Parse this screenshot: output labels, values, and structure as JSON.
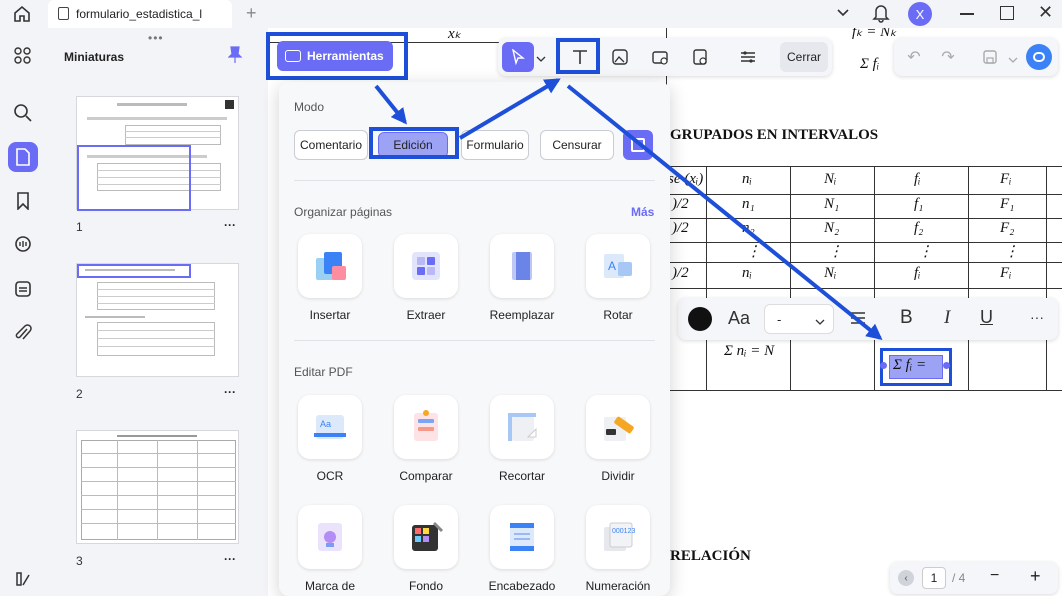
{
  "titlebar": {
    "tab_title": "formulario_estadistica_l",
    "avatar_letter": "X"
  },
  "thumbnails": {
    "title": "Miniaturas",
    "pages": [
      "1",
      "2",
      "3"
    ],
    "more": "···"
  },
  "tools_button": {
    "label": "Herramientas"
  },
  "top_toolbar": {
    "close_label": "Cerrar"
  },
  "panel": {
    "mode_title": "Modo",
    "modes": [
      "Comentario",
      "Edición",
      "Formulario",
      "Censurar"
    ],
    "organize_title": "Organizar páginas",
    "more_label": "Más",
    "organize_tools": [
      "Insertar",
      "Extraer",
      "Reemplazar",
      "Rotar"
    ],
    "edit_title": "Editar PDF",
    "edit_tools": [
      "OCR",
      "Comparar",
      "Recortar",
      "Dividir"
    ],
    "edit_tools_row2": [
      "Marca de",
      "Fondo",
      "Encabezado",
      "Numeración"
    ]
  },
  "text_toolbar": {
    "font_label": "Aa",
    "size_value": "-"
  },
  "document": {
    "heading1": "GRUPADOS EN INTERVALOS",
    "heading2": "RELACIÓN",
    "header_row": [
      "se (xᵢ)",
      "nᵢ",
      "Nᵢ",
      "fᵢ",
      "Fᵢ"
    ],
    "rows": [
      [
        ")/2",
        "n₁",
        "N₁",
        "f₁",
        "F₁"
      ],
      [
        ")/2",
        "n₂",
        "N₂",
        "f₂",
        "F₂"
      ],
      [
        "",
        "⋮",
        "⋮",
        "⋮",
        "⋮"
      ],
      [
        ")/2",
        "nᵢ",
        "Nᵢ",
        "fᵢ",
        "Fᵢ"
      ]
    ],
    "top_xk": "xₖ",
    "top_sum": "Σ fᵢ",
    "top_fk": "fₖ = Nₖ",
    "sum_n": "Σ nᵢ = N",
    "sum_f": "Σ fᵢ ="
  },
  "pagination": {
    "current": "1",
    "total": "/ 4",
    "zoom_out": "−",
    "zoom_in": "+"
  },
  "colors": {
    "accent": "#6b6cf6",
    "highlight": "#1d4fd8"
  }
}
